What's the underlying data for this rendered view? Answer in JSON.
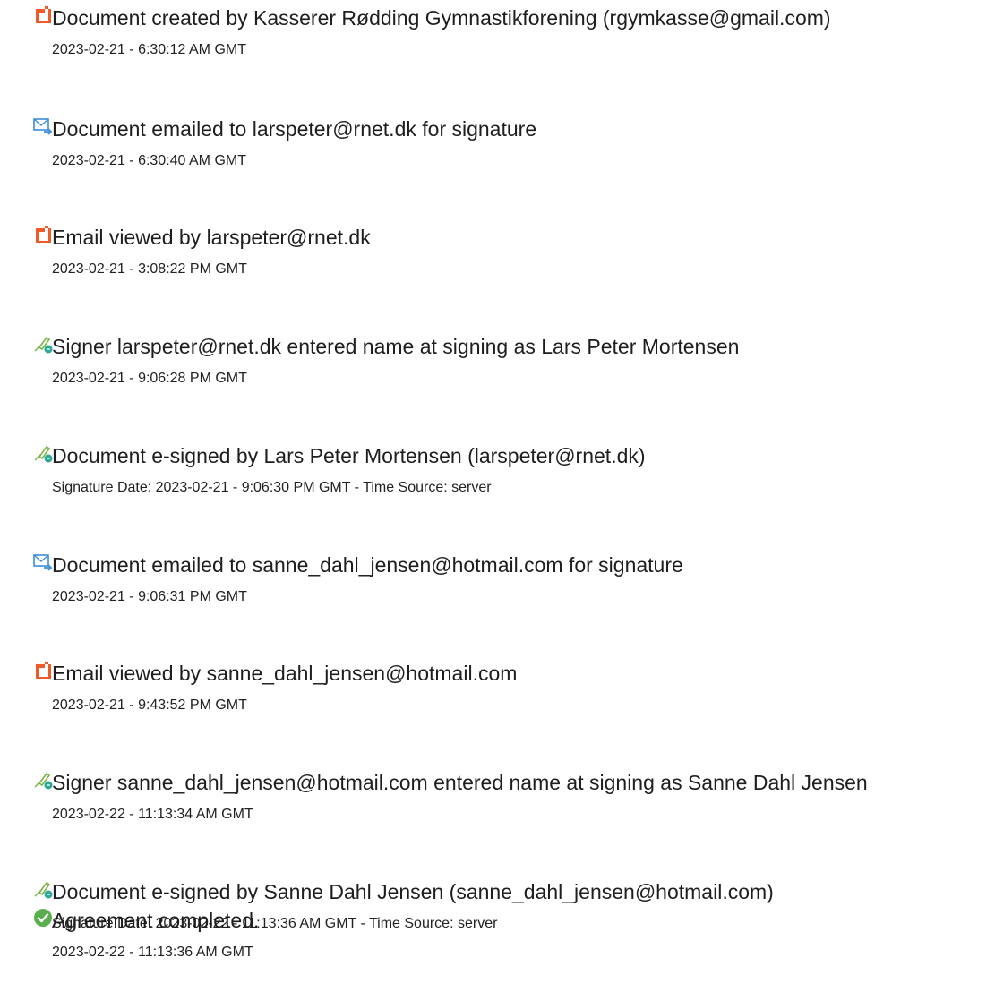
{
  "events": [
    {
      "icon": "document-created-icon",
      "title": "Document created by Kasserer Rødding Gymnastikforening (rgymkasse@gmail.com)",
      "meta": "2023-02-21 - 6:30:12 AM GMT"
    },
    {
      "icon": "email-sent-icon",
      "title": "Document emailed to larspeter@rnet.dk for signature",
      "meta": "2023-02-21 - 6:30:40 AM GMT"
    },
    {
      "icon": "document-viewed-icon",
      "title": "Email viewed by larspeter@rnet.dk",
      "meta": "2023-02-21 - 3:08:22 PM GMT"
    },
    {
      "icon": "esign-pen-icon",
      "title": "Signer larspeter@rnet.dk entered name at signing as Lars Peter Mortensen",
      "meta": "2023-02-21 - 9:06:28 PM GMT"
    },
    {
      "icon": "esign-pen-icon",
      "title": "Document e-signed by Lars Peter Mortensen (larspeter@rnet.dk)",
      "meta": "Signature Date: 2023-02-21 - 9:06:30 PM GMT - Time Source: server"
    },
    {
      "icon": "email-sent-icon",
      "title": "Document emailed to sanne_dahl_jensen@hotmail.com for signature",
      "meta": "2023-02-21 - 9:06:31 PM GMT"
    },
    {
      "icon": "document-viewed-icon",
      "title": "Email viewed by sanne_dahl_jensen@hotmail.com",
      "meta": "2023-02-21 - 9:43:52 PM GMT"
    },
    {
      "icon": "esign-pen-icon",
      "title": "Signer sanne_dahl_jensen@hotmail.com entered name at signing as Sanne Dahl Jensen",
      "meta": "2023-02-22 - 11:13:34 AM GMT"
    },
    {
      "icon": "esign-pen-icon",
      "title": "Document e-signed by Sanne Dahl Jensen (sanne_dahl_jensen@hotmail.com)",
      "meta": "Signature Date: 2023-02-22 - 11:13:36 AM GMT - Time Source: server"
    },
    {
      "icon": "checkmark-circle-icon",
      "title": "Agreement completed.",
      "meta": "2023-02-22 - 11:13:36 AM GMT"
    }
  ],
  "colors": {
    "doc_icon": "#f05a28",
    "email_icon": "#3c8ed8",
    "pen_icon": "#7ab648",
    "esign_badge": "#2aa898",
    "check_icon": "#5aae4d",
    "text": "#1e1e1e"
  }
}
